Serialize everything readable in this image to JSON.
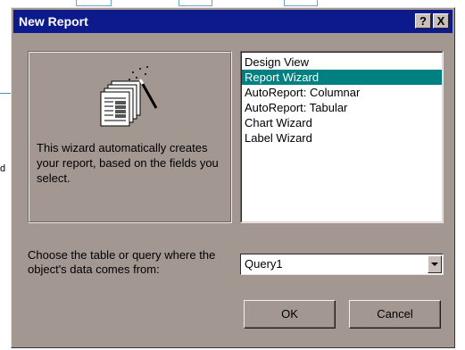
{
  "dialog": {
    "title": "New Report",
    "help_button": "?",
    "close_button": "X"
  },
  "wizard": {
    "description": "This wizard automatically creates your report, based on the fields you select."
  },
  "report_types": [
    {
      "label": "Design View",
      "selected": false
    },
    {
      "label": "Report Wizard",
      "selected": true
    },
    {
      "label": "AutoReport:  Columnar",
      "selected": false
    },
    {
      "label": "AutoReport:  Tabular",
      "selected": false
    },
    {
      "label": "Chart Wizard",
      "selected": false
    },
    {
      "label": "Label Wizard",
      "selected": false
    }
  ],
  "source": {
    "prompt": "Choose the table or query where the object's data comes from:",
    "value": "Query1"
  },
  "buttons": {
    "ok": "OK",
    "cancel": "Cancel"
  },
  "colors": {
    "title_bar": "#0c1a8c",
    "dialog_face": "#a39792",
    "selection": "#008080"
  }
}
